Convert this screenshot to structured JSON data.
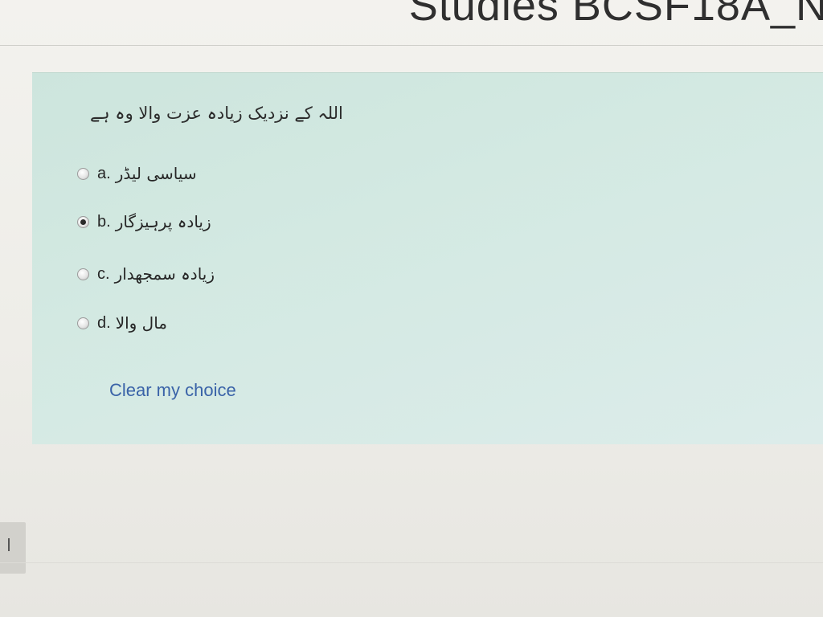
{
  "header": {
    "title": "Studies BCSF18A_N"
  },
  "question": {
    "text": "اللہ کے نزدیک زیادہ عزت والا وہ ہے",
    "options": [
      {
        "letter": "a.",
        "text": "سیاسی لیڈر",
        "selected": false
      },
      {
        "letter": "b.",
        "text": "زیادہ پرہیزگار",
        "selected": true
      },
      {
        "letter": "c.",
        "text": "زیادہ سمجھدار",
        "selected": false
      },
      {
        "letter": "d.",
        "text": "مال والا",
        "selected": false
      }
    ],
    "clear_label": "Clear my choice"
  },
  "colors": {
    "panel": "#d3e9e2",
    "link": "#3a63a8"
  }
}
